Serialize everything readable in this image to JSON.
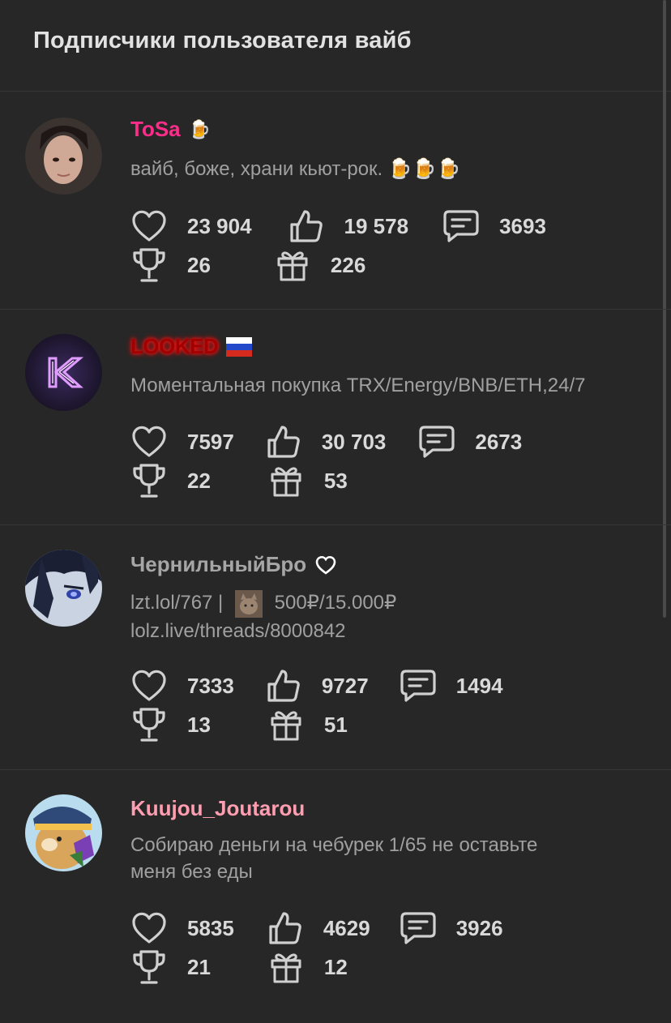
{
  "header": {
    "title": "Подписчики пользователя вайб"
  },
  "users": [
    {
      "name": "ToSa",
      "name_color": "#ff2d8a",
      "badge_emoji": "🍺",
      "status": "вайб, боже, храни кьют-рок. 🍺🍺🍺",
      "likes": "23 904",
      "thumbs": "19 578",
      "messages": "3693",
      "trophies": "26",
      "gifts": "226"
    },
    {
      "name": "LOOKED",
      "name_color": "#a00000",
      "badge": "russia-flag-icon",
      "status": "Моментальная покупка TRX/Energy/BNB/ETH,24/7",
      "likes": "7597",
      "thumbs": "30 703",
      "messages": "2673",
      "trophies": "22",
      "gifts": "53"
    },
    {
      "name": "ЧернильныйБро",
      "name_color": "#a6a6a6",
      "badge": "heart-outline-icon",
      "status_line1_a": "lzt.lol/767 |",
      "status_line1_b": "500₽/15.000₽",
      "status_line2": "lolz.live/threads/8000842",
      "likes": "7333",
      "thumbs": "9727",
      "messages": "1494",
      "trophies": "13",
      "gifts": "51"
    },
    {
      "name": "Kuujou_Joutarou",
      "name_color": "#ff9eb0",
      "status_line1": "Собираю деньги на чебурек 1/65 не оставьте",
      "status_line2": "меня без еды",
      "likes": "5835",
      "thumbs": "4629",
      "messages": "3926",
      "trophies": "21",
      "gifts": "12"
    }
  ]
}
